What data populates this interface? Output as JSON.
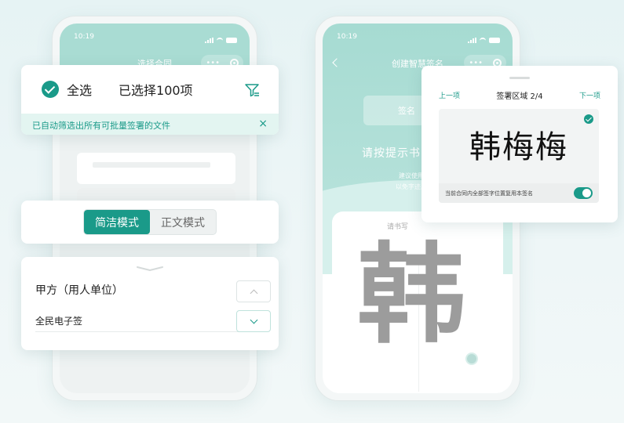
{
  "left_phone": {
    "status_time": "10:19",
    "nav_title": "选择合同",
    "capsule_dots": "•••"
  },
  "right_phone": {
    "status_time": "10:19",
    "nav_title": "创建智慧签名",
    "capsule_dots": "•••",
    "tab_label": "签名",
    "prompt_title": "请按提示书写",
    "prompt_sub_line1": "建议使用楷书",
    "prompt_sub_line2": "以免字迹原因无",
    "write_hint": "请书写",
    "big_char": "韩"
  },
  "select_card": {
    "select_all": "全选",
    "selected_count": "已选择100项",
    "notice": "已自动筛选出所有可批量签署的文件",
    "close": "×"
  },
  "mode_card": {
    "simple_mode": "简洁模式",
    "text_mode": "正文模式"
  },
  "party_card": {
    "label": "甲方（用人单位）",
    "value": "全民电子签"
  },
  "sign_area_card": {
    "prev": "上一项",
    "title": "签署区域 2/4",
    "next": "下一项",
    "signature": "韩梅梅",
    "reuse_label": "当前合同内全部签字位置复用本签名",
    "reuse_enabled": true
  },
  "colors": {
    "accent": "#1a9a89",
    "header_teal": "#a9dcd3",
    "notice_bg": "#e3f5f1"
  }
}
